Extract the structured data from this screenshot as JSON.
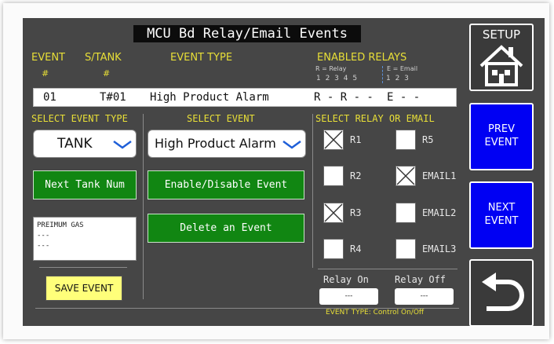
{
  "title": "MCU Bd Relay/Email Events",
  "headers": {
    "event": "EVENT",
    "event_hash": "#",
    "stank": "S/TANK",
    "stank_hash": "#",
    "event_type": "EVENT TYPE",
    "enabled_relays": "ENABLED RELAYS",
    "relay_legend": "R = Relay",
    "email_legend": "E = Email",
    "relay_nums": "1  2  3  4  5",
    "email_nums": "1  2  3"
  },
  "event_row": {
    "number": "01",
    "tank": "T#01",
    "type": "High Product Alarm",
    "relays": "R - R - -",
    "emails": "E - -"
  },
  "left": {
    "section_label": "SELECT EVENT TYPE",
    "type_dropdown_value": "TANK",
    "next_tank_label": "Next Tank Num",
    "notes_lines": [
      "PREIMUM GAS",
      "---",
      "---"
    ],
    "save_label": "SAVE EVENT"
  },
  "middle": {
    "section_label": "SELECT EVENT",
    "event_dropdown_value": "High Product Alarm",
    "enable_disable_label": "Enable/Disable Event",
    "delete_label": "Delete an Event"
  },
  "right": {
    "section_label": "SELECT RELAY OR EMAIL",
    "r1": "R1",
    "r2": "R2",
    "r3": "R3",
    "r4": "R4",
    "r5": "R5",
    "email1": "EMAIL1",
    "email2": "EMAIL2",
    "email3": "EMAIL3",
    "checked": {
      "r1": true,
      "r2": false,
      "r3": true,
      "r4": false,
      "r5": false,
      "email1": true,
      "email2": false,
      "email3": false
    },
    "relay_on_label": "Relay On",
    "relay_off_label": "Relay Off",
    "relay_on_value": "---",
    "relay_off_value": "---",
    "event_type_note": "EVENT TYPE: Control On/Off"
  },
  "sidebar": {
    "setup_label": "SETUP",
    "prev_event_line1": "PREV",
    "prev_event_line2": "EVENT",
    "next_event_line1": "NEXT",
    "next_event_line2": "EVENT"
  },
  "colors": {
    "screen_bg": "#464646",
    "header_yellow": "#e8df37",
    "button_green": "#118612",
    "button_blue": "#0000f3",
    "save_yellow": "#ffff7a"
  }
}
